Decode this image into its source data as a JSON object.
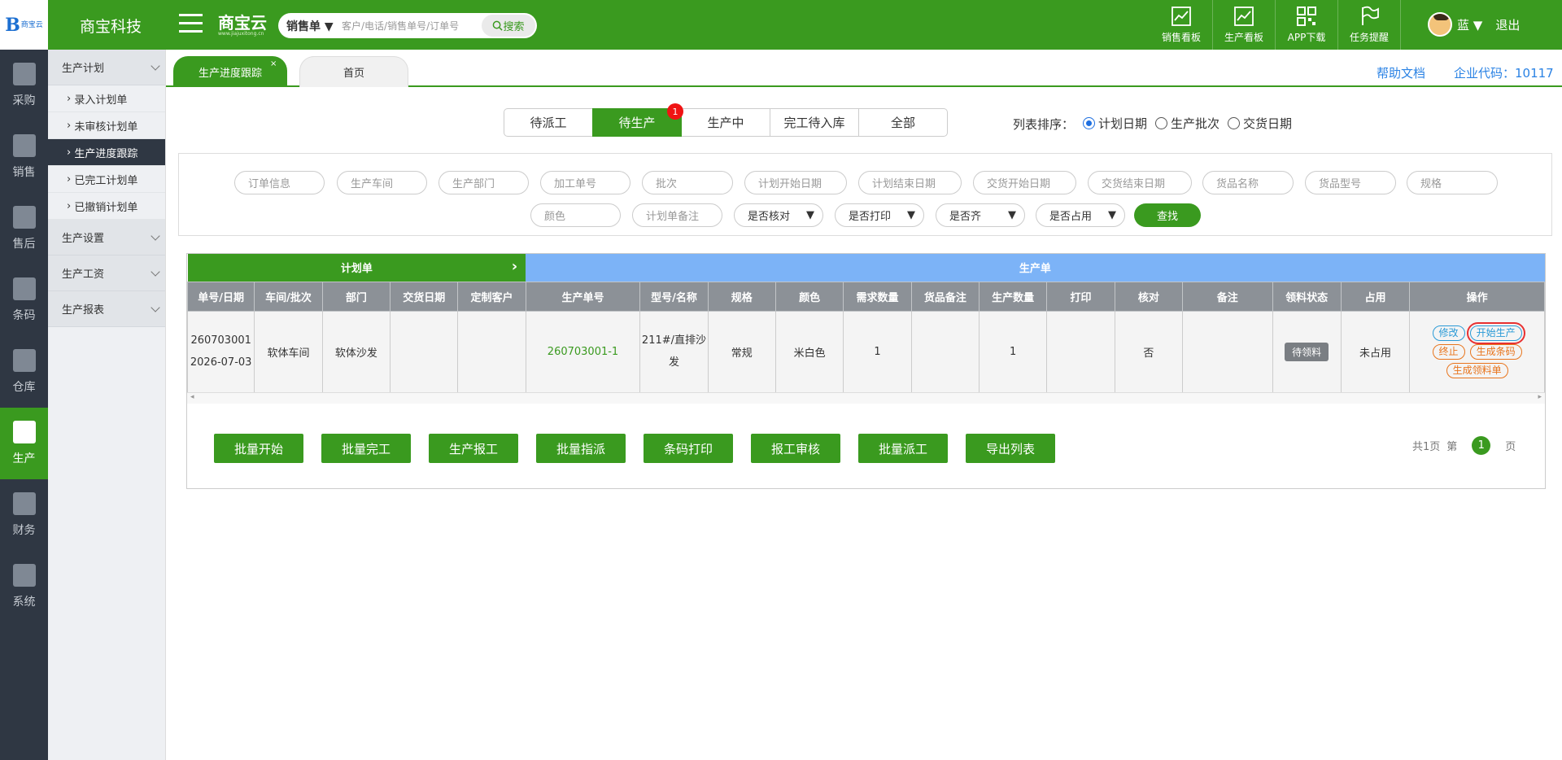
{
  "header": {
    "logo_mark": "B",
    "logo_text": "商宝云",
    "company": "商宝科技",
    "brand": "商宝云",
    "brand_sub": "www.jiajuxitong.cn",
    "search_type": "销售单 ▼",
    "search_placeholder": "客户/电话/销售单号/订单号",
    "search_button": "搜索",
    "icons": [
      {
        "label": "销售看板",
        "icon": "sales-chart-icon"
      },
      {
        "label": "生产看板",
        "icon": "production-chart-icon"
      },
      {
        "label": "APP下载",
        "icon": "qrcode-icon"
      },
      {
        "label": "任务提醒",
        "icon": "flag-icon"
      }
    ],
    "user_name": "蓝 ▼",
    "logout": "退出"
  },
  "leftnav": [
    {
      "label": "采购",
      "icon": "cart-icon"
    },
    {
      "label": "销售",
      "icon": "sales-icon"
    },
    {
      "label": "售后",
      "icon": "aftersales-icon"
    },
    {
      "label": "条码",
      "icon": "barcode-icon"
    },
    {
      "label": "仓库",
      "icon": "warehouse-icon"
    },
    {
      "label": "生产",
      "icon": "robot-arm-icon",
      "active": true
    },
    {
      "label": "财务",
      "icon": "calculator-icon"
    },
    {
      "label": "系统",
      "icon": "gear-icon"
    }
  ],
  "submenu": {
    "group1": "生产计划",
    "items": [
      "录入计划单",
      "未审核计划单",
      "生产进度跟踪",
      "已完工计划单",
      "已撤销计划单"
    ],
    "group2": "生产设置",
    "group3": "生产工资",
    "group4": "生产报表"
  },
  "tabs": {
    "active": "生产进度跟踪",
    "home": "首页",
    "close": "×",
    "help": "帮助文档",
    "corp": "企业代码：10117"
  },
  "status_tabs": [
    "待派工",
    "待生产",
    "生产中",
    "完工待入库",
    "全部"
  ],
  "badge": "1",
  "sort": {
    "label": "列表排序：",
    "options": [
      "计划日期",
      "生产批次",
      "交货日期"
    ]
  },
  "filters": {
    "row1": [
      "订单信息",
      "生产车间",
      "生产部门",
      "加工单号",
      "批次",
      "计划开始日期",
      "计划结束日期",
      "交货开始日期",
      "交货结束日期",
      "货品名称",
      "货品型号",
      "规格"
    ],
    "row2_inputs": [
      "颜色",
      "计划单备注"
    ],
    "selects": [
      "是否核对",
      "是否打印",
      "是否齐",
      "是否占用"
    ],
    "search": "查找"
  },
  "table": {
    "group_plan": "计划单",
    "group_prod": "生产单",
    "headers": [
      "单号/日期",
      "车间/批次",
      "部门",
      "交货日期",
      "定制客户",
      "生产单号",
      "型号/名称",
      "规格",
      "颜色",
      "需求数量",
      "货品备注",
      "生产数量",
      "打印",
      "核对",
      "备注",
      "领料状态",
      "占用",
      "操作"
    ],
    "row": {
      "order_no": "260703001",
      "date": "2026-07-03",
      "workshop": "软体车间",
      "dept": "软体沙发",
      "delivery": "",
      "customer": "",
      "prod_no": "260703001-1",
      "model": "211#/直排沙发",
      "spec": "常规",
      "color": "米白色",
      "qty_need": "1",
      "goods_note": "",
      "qty_prod": "1",
      "print": "",
      "check": "否",
      "note": "",
      "material": "待领料",
      "occupy": "未占用",
      "ops": [
        "修改",
        "开始生产",
        "终止",
        "生成条码",
        "生成领料单"
      ]
    }
  },
  "actions": [
    "批量开始",
    "批量完工",
    "生产报工",
    "批量指派",
    "条码打印",
    "报工审核",
    "批量派工",
    "导出列表"
  ],
  "pager": {
    "total": "共1页",
    "di": "第",
    "page": "1",
    "ye": "页"
  },
  "colors": {
    "green": "#3a9a1f",
    "blue_header": "#7cb3f7",
    "nav": "#2f3743"
  }
}
